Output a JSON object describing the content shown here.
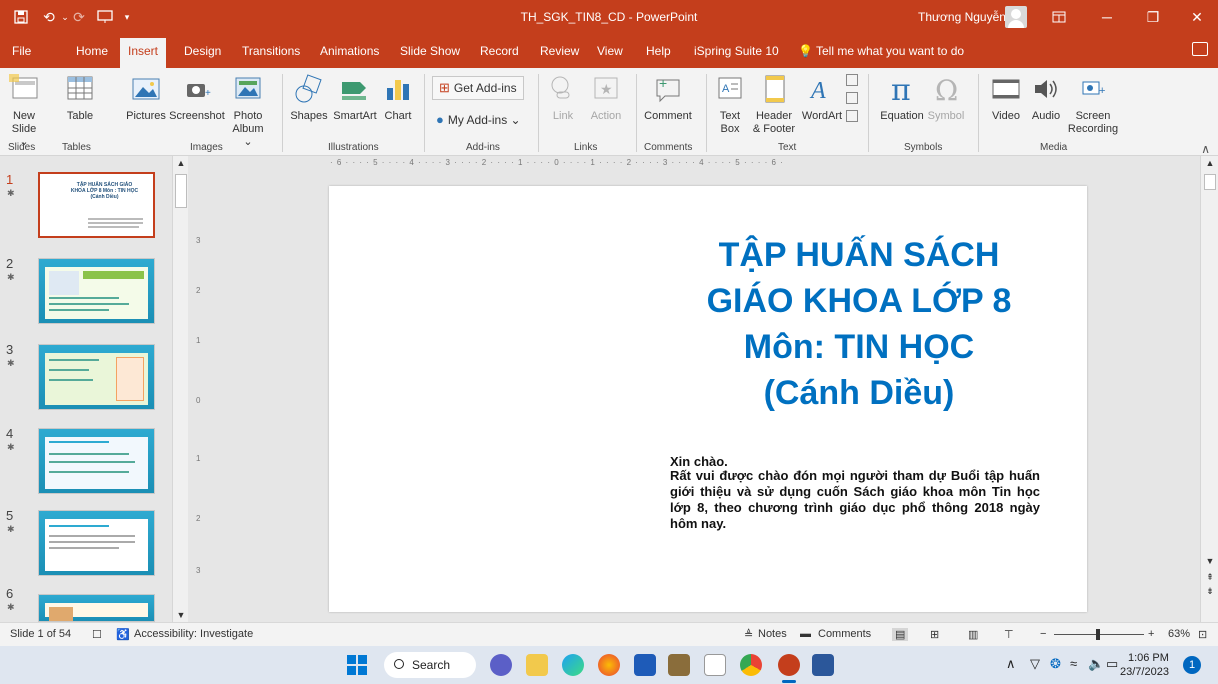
{
  "titlebar": {
    "doc_title": "TH_SGK_TIN8_CD  -  PowerPoint",
    "user": "Thương Nguyễn",
    "quick_icons": [
      "save-icon",
      "undo-icon",
      "redo-icon",
      "present-from-start-icon",
      "customize-qat-icon"
    ]
  },
  "menu": {
    "tabs": [
      "File",
      "Home",
      "Insert",
      "Design",
      "Transitions",
      "Animations",
      "Slide Show",
      "Record",
      "Review",
      "View",
      "Help",
      "iSpring Suite 10"
    ],
    "active": "Insert",
    "tell_me": "Tell me what you want to do"
  },
  "ribbon": {
    "new_slide": "New Slide ⌄",
    "table": "Table",
    "pictures": "Pictures",
    "screenshot": "Screenshot",
    "photo_album": "Photo Album ⌄",
    "shapes": "Shapes",
    "smartart": "SmartArt",
    "chart": "Chart",
    "get_addins": "Get Add-ins",
    "my_addins": "My Add-ins  ⌄",
    "link": "Link",
    "action": "Action",
    "comment": "Comment",
    "text_box": "Text Box",
    "header_footer": "Header & Footer",
    "wordart": "WordArt",
    "equation": "Equation",
    "symbol": "Symbol",
    "video": "Video",
    "audio": "Audio",
    "screen_recording": "Screen Recording",
    "groups": [
      "Slides",
      "Tables",
      "Images",
      "Illustrations",
      "Add-ins",
      "Links",
      "Comments",
      "Text",
      "Symbols",
      "Media"
    ]
  },
  "ruler": {
    "horizontal": "· 6 · · · · 5 · · · · 4 · · · · 3 · · · · 2 · · · · 1 · · · · 0 · · · · 1 · · · · 2 · · · · 3 · · · · 4 · · · · 5 · · · · 6 ·",
    "vertical": [
      "3",
      "2",
      "1",
      "0",
      "1",
      "2",
      "3"
    ]
  },
  "thumbnails": {
    "items": [
      {
        "num": "1",
        "title": "TẬP HUẤN SÁCH GIÁO KHOA LỚP 8 Môn : TIN HỌC (Cánh Diều)"
      },
      {
        "num": "2"
      },
      {
        "num": "3"
      },
      {
        "num": "4"
      },
      {
        "num": "5"
      },
      {
        "num": "6"
      }
    ]
  },
  "slide": {
    "title_lines": [
      "TẬP HUẤN SÁCH",
      "GIÁO KHOA LỚP 8",
      "Môn: TIN HỌC",
      "(Cánh Diều)"
    ],
    "greeting": "Xin chào.",
    "body": "Rất vui được chào đón mọi người tham dự Buổi tập huấn giới thiệu và sử dụng cuốn Sách giáo khoa môn Tin học lớp 8, theo chương trình giáo dục phổ thông 2018 ngày hôm nay.",
    "title_color": "#0070C0"
  },
  "status": {
    "slide_count": "Slide 1 of 54",
    "accessibility": "Accessibility: Investigate",
    "notes": "Notes",
    "comments": "Comments",
    "zoom": "63%"
  },
  "taskbar": {
    "search": "Search",
    "time": "1:06 PM",
    "date": "23/7/2023",
    "notifications": "1"
  },
  "colors": {
    "accent": "#C43E1C",
    "slide_title": "#0070C0"
  }
}
